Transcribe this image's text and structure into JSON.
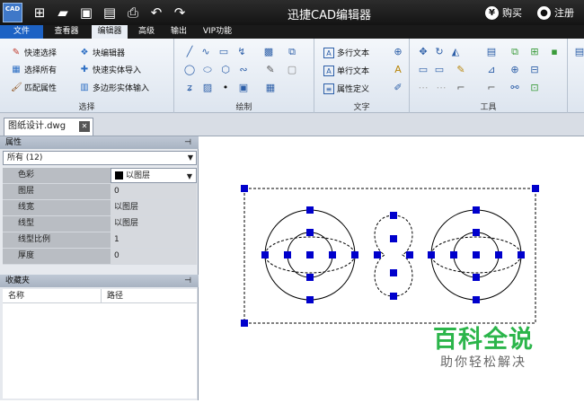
{
  "titlebar": {
    "app_icon_text": "CAD",
    "quick_access": [
      "new-icon",
      "open-icon",
      "save-icon",
      "save-as-icon",
      "print-icon",
      "undo-icon",
      "redo-icon"
    ],
    "title": "迅捷CAD编辑器",
    "buy_label": "购买",
    "register_label": "注册"
  },
  "menu_tabs": [
    "文件",
    "查看器",
    "编辑器",
    "高级",
    "输出",
    "VIP功能"
  ],
  "active_tab": "编辑器",
  "ribbon": {
    "groups": {
      "select": {
        "label": "选择",
        "buttons": [
          "快速选择",
          "块编辑器",
          "选择所有",
          "快速实体导入",
          "匹配属性",
          "多边形实体输入"
        ]
      },
      "draw": {
        "label": "绘制"
      },
      "text": {
        "label": "文字",
        "buttons": [
          "多行文本",
          "单行文本",
          "属性定义"
        ]
      },
      "tools": {
        "label": "工具"
      }
    }
  },
  "document_tab": "图纸设计.dwg",
  "properties": {
    "header": "属性",
    "filter": "所有 (12)",
    "rows": [
      {
        "name": "色彩",
        "value": "以图层"
      },
      {
        "name": "图层",
        "value": "0"
      },
      {
        "name": "线宽",
        "value": "以图层"
      },
      {
        "name": "线型",
        "value": "以图层"
      },
      {
        "name": "线型比例",
        "value": "1"
      },
      {
        "name": "厚度",
        "value": "0"
      }
    ]
  },
  "favorites": {
    "header": "收藏夹",
    "columns": [
      "名称",
      "路径"
    ]
  },
  "watermark": {
    "title": "百科全说",
    "subtitle": "助你轻松解决"
  },
  "colors": {
    "accent": "#1d62c4",
    "grip": "#0000cc",
    "watermark_green": "#2bb54a"
  }
}
